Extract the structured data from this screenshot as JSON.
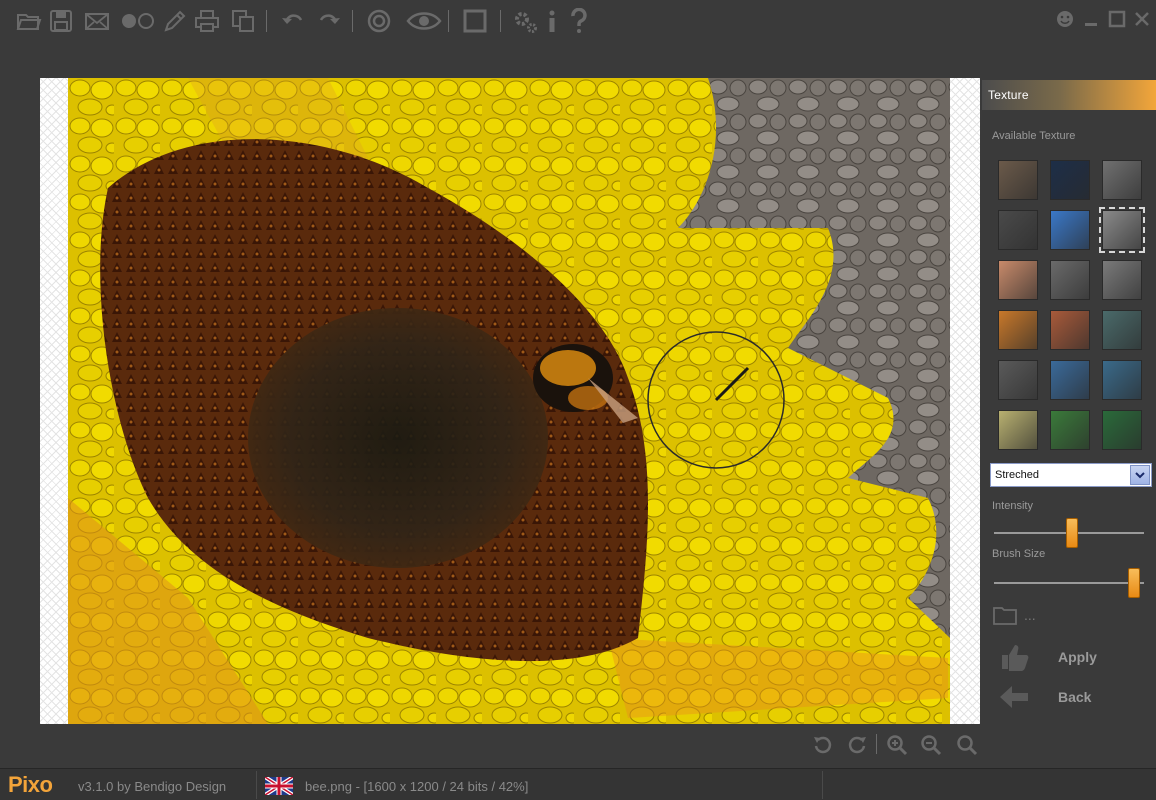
{
  "app": {
    "name": "Pixo",
    "version": "v3.1.0 by Bendigo Design"
  },
  "toolbar": {
    "items": [
      "open-folder-icon",
      "save-icon",
      "email-icon",
      "circles-icon",
      "pencil-icon",
      "print-icon",
      "copy-icon",
      "undo-icon",
      "redo-icon",
      "target-icon",
      "eye-icon",
      "crop-square-icon",
      "settings-icon",
      "info-icon",
      "help-icon"
    ]
  },
  "panel": {
    "title": "Texture",
    "available_label": "Available Texture",
    "textures": [
      "#6b5a4a",
      "#1d2e48",
      "#707070",
      "#4a4a4a",
      "#3a78c8",
      "#8a8a8a",
      "#c88a6a",
      "#6a6a6a",
      "#7a7a7a",
      "#c8782a",
      "#a85a3a",
      "#4a6a6a",
      "#5a5a5a",
      "#3a6a9a",
      "#3a6a8a",
      "#b8b070",
      "#3a7a3a",
      "#2a6a3a"
    ],
    "selected_texture": 5,
    "mode": "Streched",
    "intensity_label": "Intensity",
    "intensity": 0.52,
    "brush_label": "Brush Size",
    "brush_size": 0.97,
    "folder_text": "...",
    "apply_label": "Apply",
    "back_label": "Back"
  },
  "status": {
    "file_info": "bee.png - [1600 x 1200 / 24 bits / 42%]"
  },
  "colors": {
    "accent": "#f3a43a",
    "background": "#3a3a3a"
  }
}
